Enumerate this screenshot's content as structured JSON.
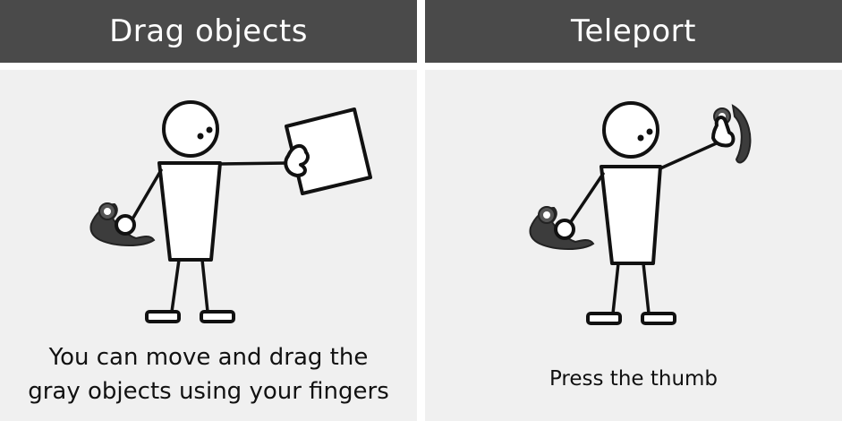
{
  "panels": {
    "drag": {
      "title": "Drag objects",
      "caption_line1": "You can move and drag the",
      "caption_line2": "gray objects using your fingers"
    },
    "teleport": {
      "title": "Teleport",
      "caption": "Press the thumb"
    }
  },
  "colors": {
    "header_bg": "#4a4a4a",
    "header_text": "#ffffff",
    "panel_bg": "#f0f0f0",
    "controller": "#3c3c3c"
  }
}
